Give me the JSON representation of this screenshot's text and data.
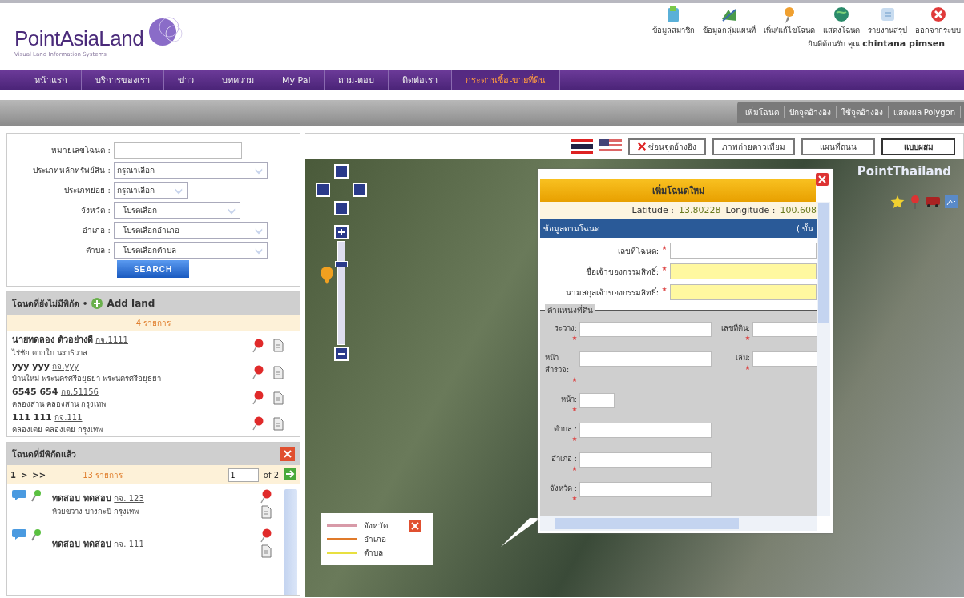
{
  "header": {
    "logo": "PointAsiaLand",
    "tagline": "Visual Land Information Systems",
    "tools": [
      {
        "label": "ข้อมูลสมาชิก"
      },
      {
        "label": "ข้อมูลกลุ่มแผนที่"
      },
      {
        "label": "เพิ่ม/แก้ไขโฉนด"
      },
      {
        "label": "แสดงโฉนด"
      },
      {
        "label": "รายงานสรุป"
      },
      {
        "label": "ออกจากระบบ"
      }
    ],
    "welcome": "ยินดีต้อนรับ คุณ",
    "user": "chintana pimsen"
  },
  "nav": [
    {
      "label": "หน้าแรก",
      "selected": false
    },
    {
      "label": "บริการของเรา",
      "selected": false
    },
    {
      "label": "ข่าว",
      "selected": false
    },
    {
      "label": "บทความ",
      "selected": false
    },
    {
      "label": "My Pal",
      "selected": false
    },
    {
      "label": "ถาม-ตอบ",
      "selected": false
    },
    {
      "label": "ติดต่อเรา",
      "selected": false
    },
    {
      "label": "กระดานซื้อ-ขายที่ดิน",
      "selected": true
    }
  ],
  "subtabs": [
    "เพิ่มโฉนด",
    "ปักจุดอ้างอิง",
    "ใช้จุดอ้างอิง",
    "แสดงผล Polygon"
  ],
  "search": {
    "fields": [
      {
        "label": "หมายเลขโฉนด :",
        "kind": "text"
      },
      {
        "label": "ประเภทหลักทรัพย์สิน :",
        "kind": "select",
        "value": "กรุณาเลือก"
      },
      {
        "label": "ประเภทย่อย :",
        "kind": "select",
        "value": "กรุณาเลือก"
      },
      {
        "label": "จังหวัด :",
        "kind": "select",
        "value": "- โปรดเลือก -"
      },
      {
        "label": "อำเภอ :",
        "kind": "select",
        "value": "- โปรดเลือกอำเภอ -"
      },
      {
        "label": "ตำบล :",
        "kind": "select",
        "value": "- โปรดเลือกตำบล -"
      }
    ],
    "button": "SEARCH"
  },
  "unlocated": {
    "title": "โฉนดที่ยังไม่มีพิกัด •",
    "add_label": "Add land",
    "count": "4 รายการ",
    "items": [
      {
        "name": "นายทดลอง ตัวอย่างดี",
        "code": "กจ.1111",
        "address": "ไร่ชัย ตากใบ นราธิวาส"
      },
      {
        "name": "yyy yyy",
        "code": "กจ.yyy",
        "address": "บ้านใหม่ พระนครศรีอยุธยา พระนครศรีอยุธยา"
      },
      {
        "name": "6545 654",
        "code": "กจ.51156",
        "address": "คลองสาน คลองสาน กรุงเทพ"
      },
      {
        "name": "111 111",
        "code": "กจ.111",
        "address": "คลองเตย คลองเตย กรุงเทพ"
      }
    ]
  },
  "located": {
    "title": "โฉนดที่มีพิกัดแล้ว",
    "pager": {
      "links": [
        "1",
        ">",
        ">>"
      ],
      "count": "13 รายการ",
      "page": "1",
      "of": "of 2"
    },
    "items": [
      {
        "name": "ทดสอบ ทดสอบ",
        "code": "กจ. 123",
        "address": "ห้วยขวาง บางกะปิ กรุงเทพ"
      },
      {
        "name": "ทดสอบ ทดสอบ",
        "code": "กจ. 111"
      }
    ]
  },
  "map": {
    "hide_button": "ซ่อนจุดอ้างอิง",
    "types": [
      {
        "label": "ภาพถ่ายดาวเทียม",
        "selected": false
      },
      {
        "label": "แผนที่ถนน",
        "selected": false
      },
      {
        "label": "แบบผสม",
        "selected": true
      }
    ],
    "brand": "PointThailand",
    "zoom": {
      "level": 0.8
    },
    "legend": [
      {
        "label": "จังหวัด",
        "color": "#d89aa8"
      },
      {
        "label": "อำเภอ",
        "color": "#e07a2a"
      },
      {
        "label": "ตำบล",
        "color": "#e8e040"
      }
    ],
    "popup": {
      "title": "เพิ่มโฉนดใหม่",
      "lat_label": "Latitude :",
      "lat": "13.80228",
      "lon_label": "Longitude :",
      "lon": "100.608",
      "section": "ข้อมูลตามโฉนด",
      "section_note": "( ขั้น",
      "fields": [
        {
          "label": "เลขที่โฉนด:",
          "required": true,
          "highlighted": false
        },
        {
          "label": "ชื่อเจ้าของกรรมสิทธิ์:",
          "required": true,
          "highlighted": true
        },
        {
          "label": "นามสกุลเจ้าของกรรมสิทธิ์:",
          "required": true,
          "highlighted": true
        }
      ],
      "location_title": "ตำแหน่งที่ดิน",
      "location_rows": [
        [
          {
            "label": "ระวาง:"
          },
          {
            "label": "เลขที่ดิน:"
          }
        ],
        [
          {
            "label": "หน้าสำรวจ:"
          },
          {
            "label": "เล่ม:"
          }
        ],
        [
          {
            "label": "หน้า:"
          }
        ],
        [
          {
            "label": "ตำบล :"
          }
        ],
        [
          {
            "label": "อำเภอ :"
          }
        ],
        [
          {
            "label": "จังหวัด :"
          }
        ]
      ]
    }
  }
}
